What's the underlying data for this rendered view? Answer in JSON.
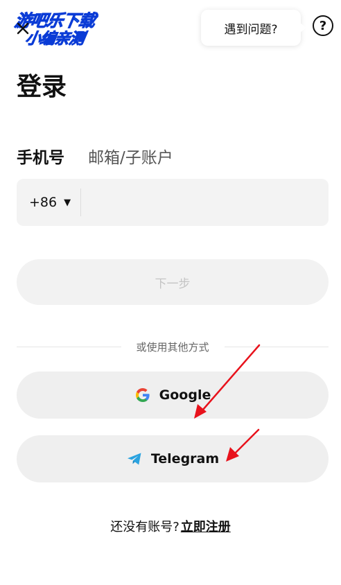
{
  "watermark": {
    "line1": "游吧乐下载",
    "line2": "小编亲测"
  },
  "header": {
    "close_icon": "close-icon",
    "help_bubble": "遇到问题?",
    "help_icon": "question-circle-icon",
    "help_icon_glyph": "?"
  },
  "title": "登录",
  "tabs": [
    {
      "label": "手机号",
      "active": true
    },
    {
      "label": "邮箱/子账户",
      "active": false
    }
  ],
  "phone": {
    "country_code": "+86",
    "caret_glyph": "▼",
    "value": "",
    "placeholder": ""
  },
  "next_button": "下一步",
  "divider_text": "或使用其他方式",
  "social": {
    "google": {
      "label": "Google",
      "icon": "google-icon"
    },
    "telegram": {
      "label": "Telegram",
      "icon": "telegram-icon"
    }
  },
  "signup": {
    "prompt": "还没有账号?",
    "link": "立即注册"
  },
  "colors": {
    "annotation_arrow": "#e8121c",
    "watermark_fill": "#2fd3f0",
    "watermark_stroke": "#0a3bd6",
    "telegram_blue": "#2aa3e0"
  }
}
